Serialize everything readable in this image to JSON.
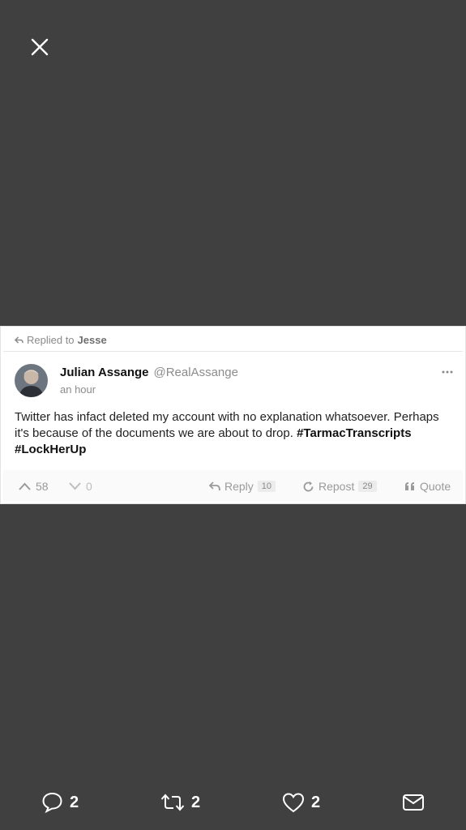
{
  "viewer": {
    "close_icon": "close-icon"
  },
  "post": {
    "replied_prefix": "Replied to",
    "replied_to": "Jesse",
    "author_name": "Julian Assange",
    "author_handle": "@RealAssange",
    "time": "an hour",
    "text_plain": "Twitter has infact deleted my account with no explanation whatsoever. Perhaps it's because of the documents we are about to drop.",
    "hashtag_1": "#TarmacTranscripts",
    "hashtag_2": "#LockHerUp"
  },
  "actions": {
    "upvotes": "58",
    "downvotes": "0",
    "reply_label": "Reply",
    "reply_count": "10",
    "repost_label": "Repost",
    "repost_count": "29",
    "quote_label": "Quote"
  },
  "bottom_bar": {
    "replies": "2",
    "retweets": "2",
    "likes": "2"
  },
  "colors": {
    "background": "#404040",
    "card": "#ffffff",
    "muted_text": "#8c8c8c"
  }
}
